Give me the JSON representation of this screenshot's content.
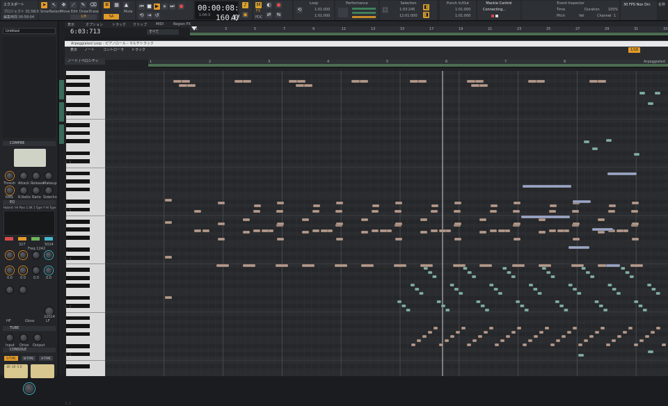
{
  "colors": {
    "accent": "#e29a2a",
    "note_brown": "#b49a8c",
    "note_teal": "#7fb0a6",
    "note_blue": "#9aa6c6"
  },
  "control_bar": {
    "export_label": "エクスポート",
    "recent_project": "プロジェクト 01:58:04",
    "recent_time": "編集時間 00:58:04",
    "tool_labels": [
      "Smart",
      "Select",
      "Move",
      "Edit",
      "Draw",
      "Erase"
    ],
    "tool_mode": "1/8",
    "snap_label": "SA",
    "mix_label": "Mute",
    "transport_time": "00:00:08:16",
    "transport_sub": "1:04:3",
    "tempo": "160.00",
    "meter": "4/4",
    "key": "1",
    "m_label": "M",
    "fx_label": "FX",
    "pdc_label": "PDC",
    "loop_title": "Loop",
    "loop_start": "1:01:000",
    "loop_end": "1:01:000",
    "perf_title": "Performance",
    "sel_title": "Selection",
    "sel_start": "1:03:245",
    "sel_end": "12:01:000",
    "punch_title": "Punch In/Out",
    "punch_start": "1:01:000",
    "punch_end": "1:01:000",
    "mackie_title": "Mackie Control",
    "mackie_status": "Connecting...",
    "event_title": "Event Inspector",
    "ev_time": "Time",
    "ev_duration": "Duration",
    "ev_duration_val": "100%",
    "ev_pitch": "Pitch",
    "ev_vel": "Vel",
    "ev_channel": "Channel",
    "ev_channel_val": "1",
    "fps": "30 FPS Non Drc",
    "tab_label": "名称"
  },
  "inspector": {
    "track_name": "Untitled",
    "comp_title": "COMPRE",
    "comp_knobs": [
      "Thresh",
      "Attack",
      "Release",
      "Makeup",
      "RMS",
      "R.Ratio",
      "Ratio",
      "Sidechn"
    ],
    "eq_title": "EQ",
    "eq_info": "Hybrid / Hi Pass  1.4K 1 Type Y  Hi Type",
    "eq_vals": [
      "327",
      "Freq 1242",
      "5024"
    ],
    "eq_bands": [
      "HF",
      "Gloss",
      "LF"
    ],
    "eq_gains": [
      "0.0",
      "0.0",
      "0.0",
      "0.0"
    ],
    "eq_freq": "22024",
    "tube_title": "TUBE",
    "tube_knobs": [
      "Input",
      "Drive",
      "Output"
    ],
    "console_title": "CONSOLE",
    "console_types": [
      "S-TYPE",
      "N-TYPE",
      "A-TYPE"
    ],
    "meter_scale": "-20 -10 -5 0"
  },
  "position_readout": "6:03:713",
  "track_view": {
    "menu": [
      "表示",
      "オプション",
      "トラック",
      "クリップ",
      "MIDI",
      "Region FX"
    ],
    "quant_value": "すべて",
    "ruler_marks": [
      "1",
      "3",
      "5",
      "7",
      "9",
      "11",
      "13",
      "15",
      "17",
      "19",
      "21",
      "23",
      "25",
      "27",
      "29",
      "31",
      "33"
    ]
  },
  "piano_roll": {
    "title": "Arpeggiated Loop - ピアノロール - マルチトラック",
    "menu": [
      "表示",
      "ノート",
      "コントローラ",
      "トラック"
    ],
    "snap_value": "1/16",
    "velocity_label": "ノート / ベロシティ",
    "ruler_marks": [
      "1",
      "2",
      "3",
      "4",
      "5",
      "6",
      "7",
      "8"
    ],
    "key_labels": [
      "C 7",
      "C 6",
      "C 5",
      "C 4",
      "C 3",
      "C 2",
      "C 1"
    ],
    "clip_label": "Arpeggiated"
  }
}
